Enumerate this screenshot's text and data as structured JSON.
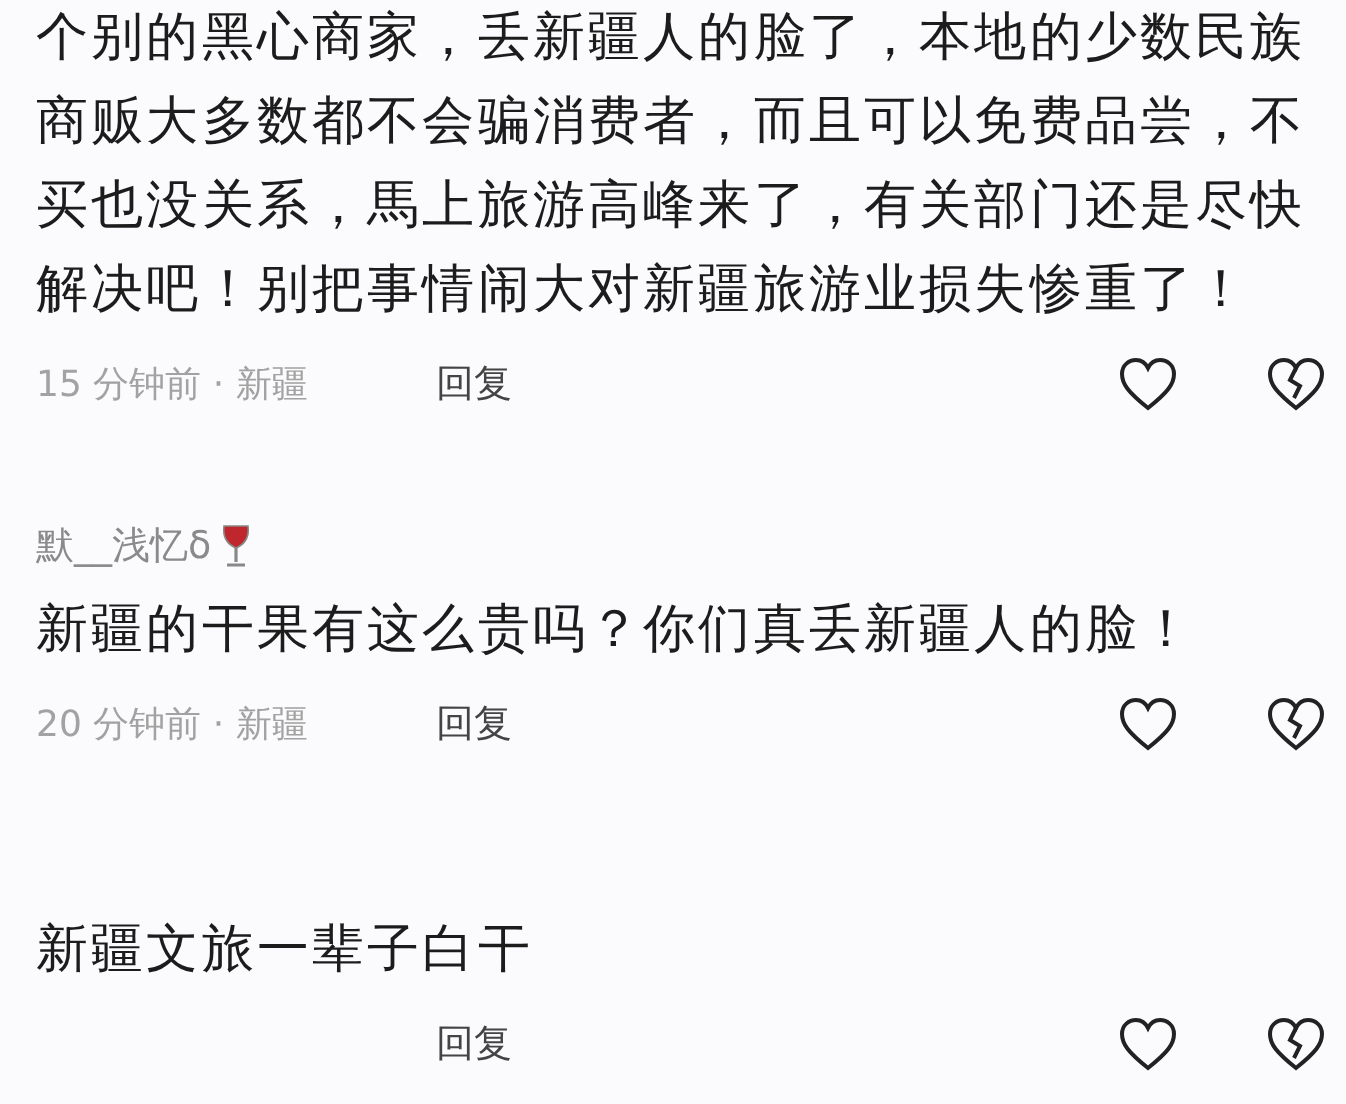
{
  "comments": [
    {
      "text": "个别的黑心商家，丢新疆人的脸了，本地的少数民族商贩大多数都不会骗消费者，而且可以免费品尝，不买也没关系，馬上旅游高峰来了，有关部门还是尽快解决吧！别把事情闹大对新疆旅游业损失惨重了！",
      "meta": "15 分钟前 · 新疆",
      "reply": "回复"
    },
    {
      "username": "默__浅忆δ",
      "text": "新疆的干果有这么贵吗？你们真丢新疆人的脸！",
      "meta": "20 分钟前 · 新疆",
      "reply": "回复"
    },
    {
      "text": "新疆文旅一辈子白干",
      "reply": "回复"
    }
  ]
}
